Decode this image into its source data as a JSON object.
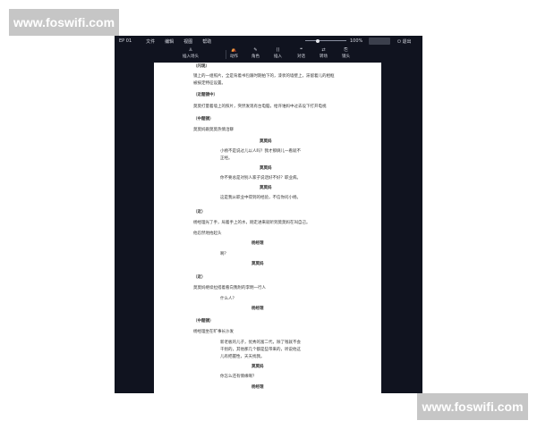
{
  "watermark": {
    "top": "www.foswifi.com",
    "bottom": "www.foswifi.com"
  },
  "menubar": {
    "episode": "EP 01",
    "menus": [
      "文件",
      "编辑",
      "视图",
      "帮助"
    ],
    "zoom": "100%",
    "zoom_level": 0.3,
    "disabled_button": "",
    "exit": "⏻ 退出"
  },
  "toolbar": {
    "tools": [
      {
        "icon": "insert-heading-icon",
        "glyph": "♙",
        "label": "插入场头"
      },
      {
        "icon": "action-icon",
        "glyph": "⛺",
        "label": "动作"
      },
      {
        "icon": "character-icon",
        "glyph": "✎",
        "label": "角色"
      },
      {
        "icon": "insert-icon",
        "glyph": "()",
        "label": "插入"
      },
      {
        "icon": "dialogue-icon",
        "glyph": "❝",
        "label": "对话"
      },
      {
        "icon": "transition-icon",
        "glyph": "⇄",
        "label": "转场"
      },
      {
        "icon": "shot-icon",
        "glyph": "⎘",
        "label": "镜头"
      }
    ]
  },
  "script": {
    "lines": [
      {
        "type": "scene",
        "text": "（闪现）"
      },
      {
        "type": "action",
        "text": "镜上的一组照片，全是背着书包跟时期拍下的，漆状的墙壁上，滞留着儿的相框"
      },
      {
        "type": "action",
        "text": "被按定特征设置。"
      },
      {
        "type": "scene",
        "text": "（近题镜中）"
      },
      {
        "type": "action",
        "text": "莫莫打量着墙上的照片，突然发现有台电脑，给许谁妈中过去设下打开电视"
      },
      {
        "type": "scene",
        "text": "（中题镜）"
      },
      {
        "type": "action",
        "text": "莫莫妈跟莫莫热情洽聊"
      },
      {
        "type": "char",
        "text": "莫莫妈"
      },
      {
        "type": "dialogue",
        "text": "小杨不是说过儿以人吗？我才那俩儿一看就不"
      },
      {
        "type": "dialogue",
        "text": "正经。"
      },
      {
        "type": "char",
        "text": "莫莫妈"
      },
      {
        "type": "dialogue",
        "text": "你不要总是对别人家子说话好不好？职业病。"
      },
      {
        "type": "char",
        "text": "莫莫妈"
      },
      {
        "type": "dialogue",
        "text": "这是我从职业中得到的经验，不信你问小杨。"
      },
      {
        "type": "scene",
        "text": "（近）"
      },
      {
        "type": "action",
        "text": "杨经理光了手，局着手上的水，刚走进来就听到莫莫妈在叫自己。"
      },
      {
        "type": "action",
        "text": "他忍然地抬起头"
      },
      {
        "type": "char",
        "text": "杨经理"
      },
      {
        "type": "dialogue",
        "text": "啊？"
      },
      {
        "type": "char",
        "text": "莫莫妈"
      },
      {
        "type": "scene",
        "text": "（近）"
      },
      {
        "type": "action",
        "text": "莫莫妈继续拉搭着看向我附的李明一行人"
      },
      {
        "type": "dialogue",
        "text": "什么人？"
      },
      {
        "type": "char",
        "text": "杨经理"
      },
      {
        "type": "scene",
        "text": "（中题镜）"
      },
      {
        "type": "action",
        "text": "杨经理坐在旷事长沙发"
      },
      {
        "type": "dialogue",
        "text": "新老板的儿子，优秀的富二代，除了钱就不会"
      },
      {
        "type": "dialogue",
        "text": "干别的，其他那几个都是些带来的，听说他这"
      },
      {
        "type": "dialogue",
        "text": "儿有把握性，天天找我。"
      },
      {
        "type": "char",
        "text": "莫莫妈"
      },
      {
        "type": "dialogue",
        "text": "你怎么还有情缘啊？"
      },
      {
        "type": "char",
        "text": "杨经理"
      }
    ]
  }
}
